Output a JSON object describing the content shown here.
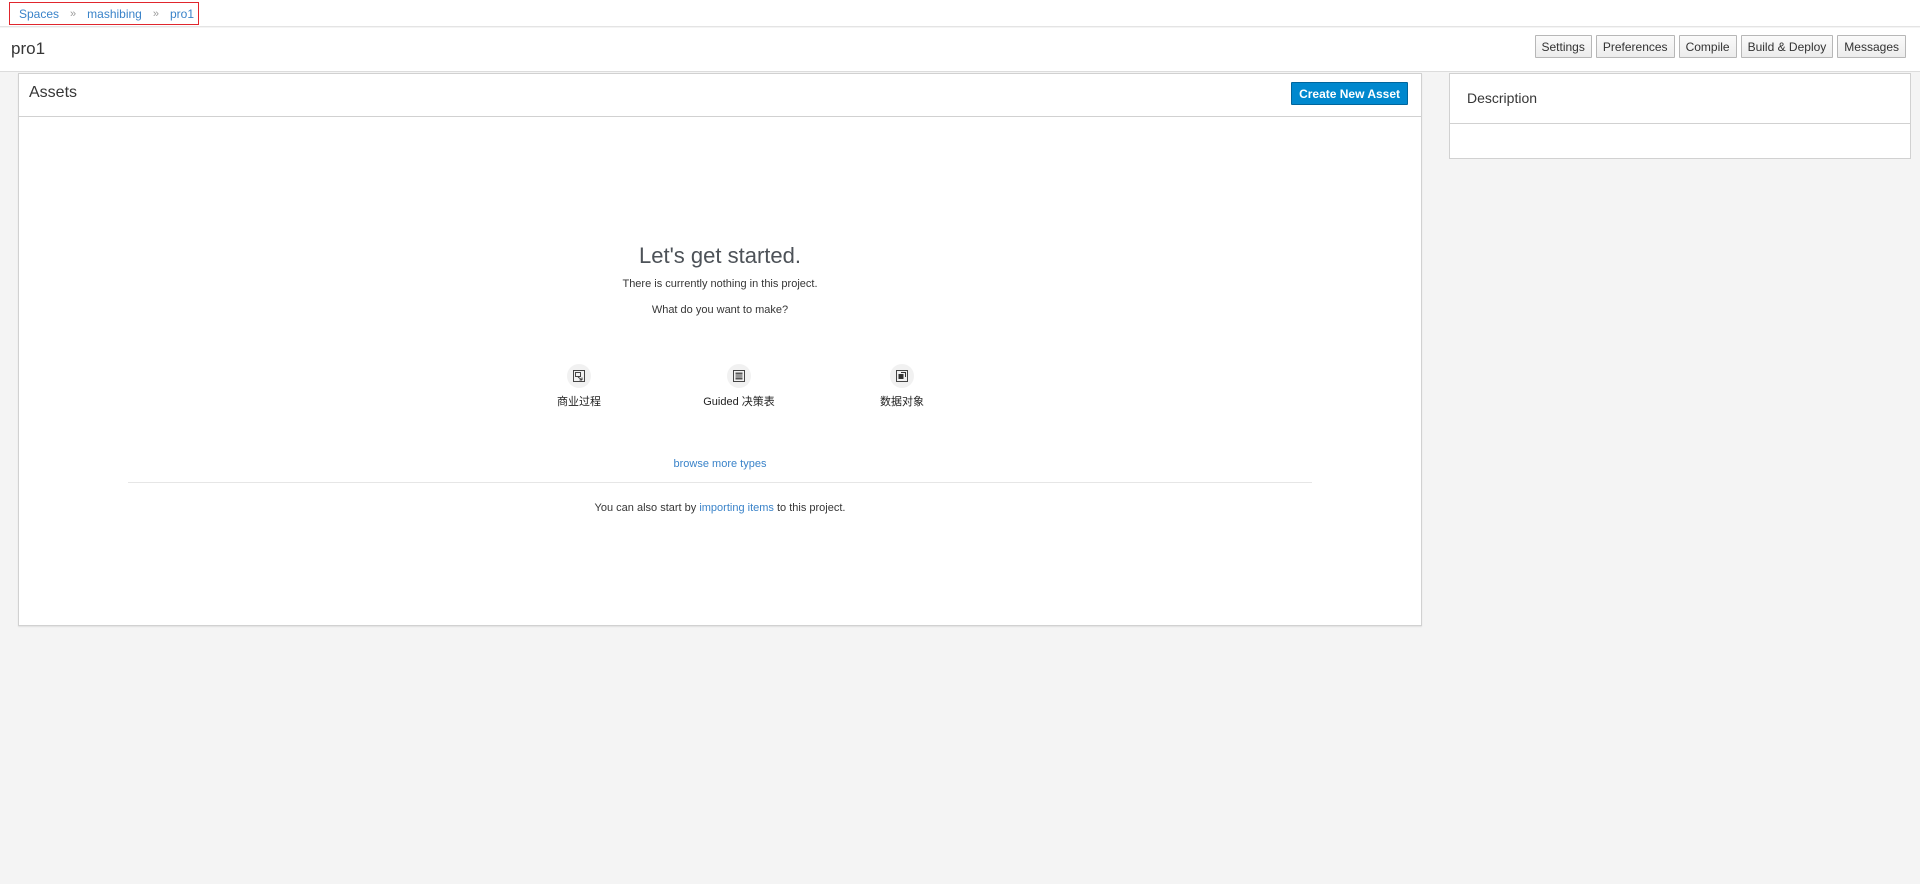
{
  "breadcrumb": {
    "items": [
      "Spaces",
      "mashibing",
      "pro1"
    ],
    "separator": "»"
  },
  "header": {
    "title": "pro1",
    "buttons": [
      "Settings",
      "Preferences",
      "Compile",
      "Build & Deploy",
      "Messages"
    ]
  },
  "assets": {
    "title": "Assets",
    "create_label": "Create New Asset",
    "empty": {
      "title": "Let's get started.",
      "line1": "There is currently nothing in this project.",
      "line2": "What do you want to make?"
    },
    "types": [
      {
        "label": "商业过程",
        "icon": "business-process-icon"
      },
      {
        "label": "Guided 决策表",
        "icon": "decision-table-icon"
      },
      {
        "label": "数据对象",
        "icon": "data-object-icon"
      }
    ],
    "browse_more": "browse more types",
    "import": {
      "prefix": "You can also start by",
      "link": "importing items",
      "suffix": "to this project."
    }
  },
  "description": {
    "title": "Description"
  },
  "colors": {
    "link": "#3a83c9",
    "primary_button": "#0088ce",
    "highlight_border": "#e0262d",
    "background": "#f4f4f4"
  }
}
